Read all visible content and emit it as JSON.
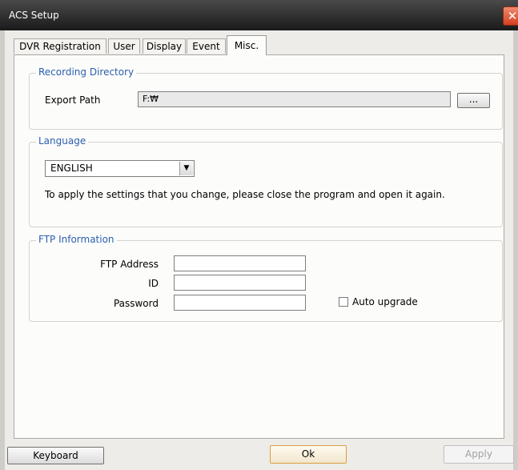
{
  "window": {
    "title": "ACS Setup",
    "close_glyph": "✕"
  },
  "tabs": [
    {
      "label": "DVR Registration"
    },
    {
      "label": "User"
    },
    {
      "label": "Display"
    },
    {
      "label": "Event"
    },
    {
      "label": "Misc."
    }
  ],
  "active_tab": "Misc.",
  "recording_directory": {
    "title": "Recording Directory",
    "export_path_label": "Export Path",
    "export_path_value": "F:₩",
    "browse_label": "..."
  },
  "language": {
    "title": "Language",
    "selected": "ENGLISH",
    "dropdown_icon": "chevron-down-icon",
    "note": "To apply the settings that you change, please close the program and open it again."
  },
  "ftp": {
    "title": "FTP Information",
    "address_label": "FTP Address",
    "address_value": "",
    "id_label": "ID",
    "id_value": "",
    "password_label": "Password",
    "password_value": "",
    "auto_upgrade_label": "Auto upgrade",
    "auto_upgrade_checked": false
  },
  "footer": {
    "keyboard_label": "Keyboard",
    "ok_label": "Ok",
    "apply_label": "Apply",
    "apply_enabled": false
  },
  "colors": {
    "titlebar": "#1a1a1a",
    "group_title": "#2b5fae",
    "close_button": "#d4401f",
    "ok_border": "#d8a040"
  }
}
